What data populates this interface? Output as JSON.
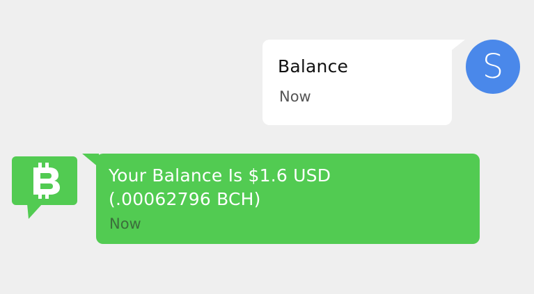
{
  "conversation": {
    "outgoing": {
      "avatar_initial": "S",
      "text": "Balance",
      "time": "Now"
    },
    "incoming": {
      "text_line1": "Your Balance Is $1.6 USD",
      "text_line2": "(.00062796 BCH)",
      "time": "Now"
    }
  },
  "icons": {
    "bot_icon": "bitcoin-chat-icon"
  },
  "colors": {
    "background": "#efefef",
    "outgoing_bubble": "#ffffff",
    "incoming_bubble": "#52cb52",
    "avatar": "#4a88ea",
    "bot_icon": "#52cb52"
  }
}
